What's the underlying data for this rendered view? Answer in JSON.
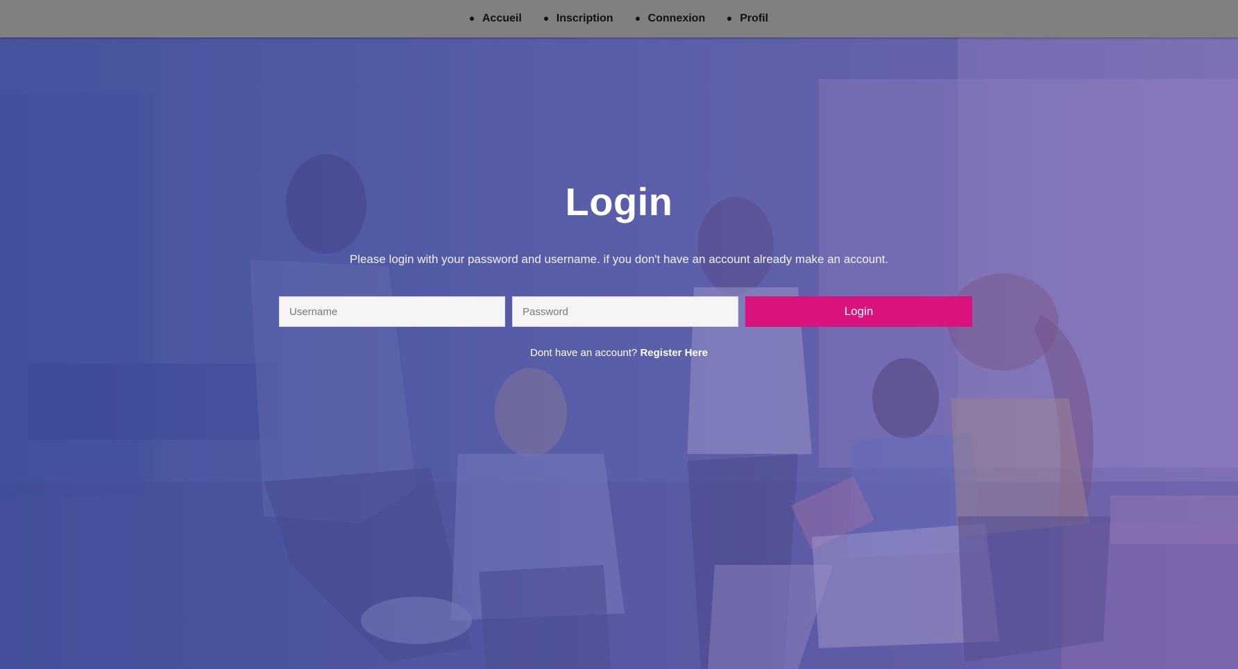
{
  "nav": {
    "items": [
      {
        "label": "Accueil"
      },
      {
        "label": "Inscription"
      },
      {
        "label": "Connexion"
      },
      {
        "label": "Profil"
      }
    ]
  },
  "login": {
    "title": "Login",
    "subtitle": "Please login with your password and username. if you don't have an account already make an account.",
    "username_placeholder": "Username",
    "password_placeholder": "Password",
    "submit_label": "Login",
    "register_prompt": "Dont have an account?",
    "register_link": "Register Here"
  },
  "colors": {
    "nav_background": "#808080",
    "primary_button": "#d9127e",
    "hero_gradient_start": "#3f4e9a",
    "hero_gradient_end": "#8a6db1"
  }
}
